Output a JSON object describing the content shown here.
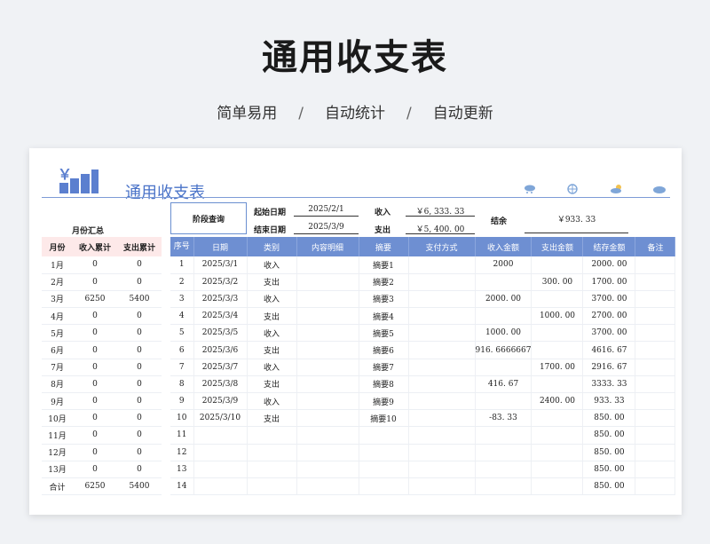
{
  "page": {
    "title": "通用收支表",
    "subtitle": [
      "简单易用",
      "自动统计",
      "自动更新"
    ],
    "separator": "/"
  },
  "sheet": {
    "title": "通用收支表",
    "start_date_label": "起始日期",
    "start_date": "2025/2/1",
    "end_date_label": "结束日期",
    "end_date": "2025/3/9",
    "income_label": "收入",
    "income_value": "￥6, 333. 33",
    "expense_label": "支出",
    "expense_value": "￥5, 400. 00",
    "balance_label": "结余",
    "balance_value": "￥933. 33",
    "query_label": "阶段查询",
    "logo_char": "￥",
    "icons": [
      "cloud-snow-icon",
      "snowflake-icon",
      "sun-cloud-icon",
      "cloud-icon"
    ],
    "colors": {
      "accent": "#4a73c8",
      "header_bg": "#6e8fd2",
      "summary_header_bg": "#fde9e9"
    }
  },
  "summary": {
    "title": "月份汇总",
    "headers": [
      "月份",
      "收入累计",
      "支出累计"
    ],
    "rows": [
      [
        "1月",
        "0",
        "0"
      ],
      [
        "2月",
        "0",
        "0"
      ],
      [
        "3月",
        "6250",
        "5400"
      ],
      [
        "4月",
        "0",
        "0"
      ],
      [
        "5月",
        "0",
        "0"
      ],
      [
        "6月",
        "0",
        "0"
      ],
      [
        "7月",
        "0",
        "0"
      ],
      [
        "8月",
        "0",
        "0"
      ],
      [
        "9月",
        "0",
        "0"
      ],
      [
        "10月",
        "0",
        "0"
      ],
      [
        "11月",
        "0",
        "0"
      ],
      [
        "12月",
        "0",
        "0"
      ],
      [
        "13月",
        "0",
        "0"
      ],
      [
        "合计",
        "6250",
        "5400"
      ]
    ]
  },
  "ledger": {
    "headers": [
      "序号",
      "日期",
      "类别",
      "内容明细",
      "摘要",
      "支付方式",
      "收入金额",
      "支出金额",
      "结存金额",
      "备注"
    ],
    "rows": [
      [
        "1",
        "2025/3/1",
        "收入",
        "",
        "摘要1",
        "",
        "2000",
        "",
        "2000. 00",
        ""
      ],
      [
        "2",
        "2025/3/2",
        "支出",
        "",
        "摘要2",
        "",
        "",
        "300. 00",
        "1700. 00",
        ""
      ],
      [
        "3",
        "2025/3/3",
        "收入",
        "",
        "摘要3",
        "",
        "2000. 00",
        "",
        "3700. 00",
        ""
      ],
      [
        "4",
        "2025/3/4",
        "支出",
        "",
        "摘要4",
        "",
        "",
        "1000. 00",
        "2700. 00",
        ""
      ],
      [
        "5",
        "2025/3/5",
        "收入",
        "",
        "摘要5",
        "",
        "1000. 00",
        "",
        "3700. 00",
        ""
      ],
      [
        "6",
        "2025/3/6",
        "支出",
        "",
        "摘要6",
        "",
        "916. 6666667",
        "",
        "4616. 67",
        ""
      ],
      [
        "7",
        "2025/3/7",
        "收入",
        "",
        "摘要7",
        "",
        "",
        "1700. 00",
        "2916. 67",
        ""
      ],
      [
        "8",
        "2025/3/8",
        "支出",
        "",
        "摘要8",
        "",
        "416. 67",
        "",
        "3333. 33",
        ""
      ],
      [
        "9",
        "2025/3/9",
        "收入",
        "",
        "摘要9",
        "",
        "",
        "2400. 00",
        "933. 33",
        ""
      ],
      [
        "10",
        "2025/3/10",
        "支出",
        "",
        "摘要10",
        "",
        "-83. 33",
        "",
        "850. 00",
        ""
      ],
      [
        "11",
        "",
        "",
        "",
        "",
        "",
        "",
        "",
        "850. 00",
        ""
      ],
      [
        "12",
        "",
        "",
        "",
        "",
        "",
        "",
        "",
        "850. 00",
        ""
      ],
      [
        "13",
        "",
        "",
        "",
        "",
        "",
        "",
        "",
        "850. 00",
        ""
      ],
      [
        "14",
        "",
        "",
        "",
        "",
        "",
        "",
        "",
        "850. 00",
        ""
      ]
    ]
  }
}
